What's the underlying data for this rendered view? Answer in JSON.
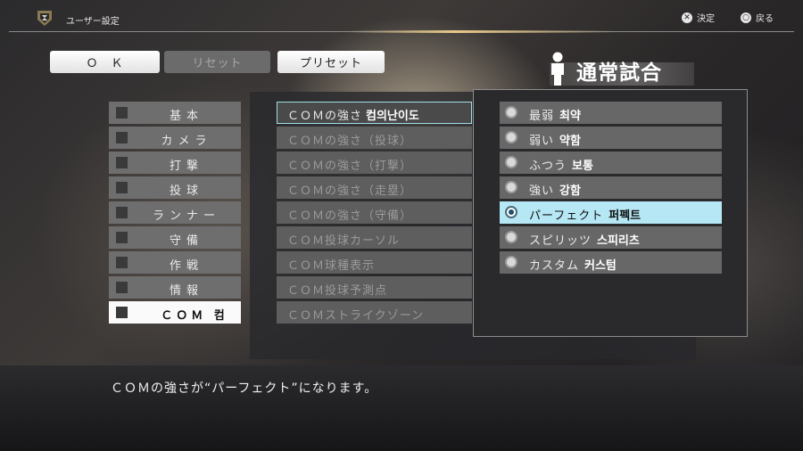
{
  "header": {
    "title": "ユーザー設定",
    "confirm_label": "決定",
    "back_label": "戻る",
    "confirm_icon": "cross-button-icon",
    "back_icon": "circle-button-icon"
  },
  "toolbar": {
    "ok_label": "Ｏ　Ｋ",
    "reset_label": "リセット",
    "preset_label": "プリセット"
  },
  "mode": {
    "title": "通常試合",
    "icon": "person-icon"
  },
  "categories": [
    {
      "label": "基本"
    },
    {
      "label": "カメラ"
    },
    {
      "label": "打撃"
    },
    {
      "label": "投球"
    },
    {
      "label": "ランナー"
    },
    {
      "label": "守備"
    },
    {
      "label": "作戦"
    },
    {
      "label": "情報"
    },
    {
      "label": "ＣＯＭ",
      "kr": "컴",
      "selected": true
    }
  ],
  "settings": [
    {
      "label": "ＣＯＭの強さ",
      "kr": "컴의난이도",
      "selected": true
    },
    {
      "label": "ＣＯＭの強さ（投球）"
    },
    {
      "label": "ＣＯＭの強さ（打撃）"
    },
    {
      "label": "ＣＯＭの強さ（走塁）"
    },
    {
      "label": "ＣＯＭの強さ（守備）"
    },
    {
      "label": "ＣＯＭ投球カーソル"
    },
    {
      "label": "ＣＯＭ球種表示"
    },
    {
      "label": "ＣＯＭ投球予測点"
    },
    {
      "label": "ＣＯＭストライクゾーン"
    }
  ],
  "options": [
    {
      "label": "最弱",
      "kr": "최약"
    },
    {
      "label": "弱い",
      "kr": "약함"
    },
    {
      "label": "ふつう",
      "kr": "보통"
    },
    {
      "label": "強い",
      "kr": "강함"
    },
    {
      "label": "パーフェクト",
      "kr": "퍼펙트",
      "selected": true
    },
    {
      "label": "スピリッツ",
      "kr": "스피리츠"
    },
    {
      "label": "カスタム",
      "kr": "커스텀"
    }
  ],
  "message": "ＣＯＭの強さが“パーフェクト”になります。",
  "colors": {
    "selected_option_bg": "#b6e7f5",
    "selected_setting_border": "#9fdfe8",
    "accent_line": "#e8c98a"
  }
}
